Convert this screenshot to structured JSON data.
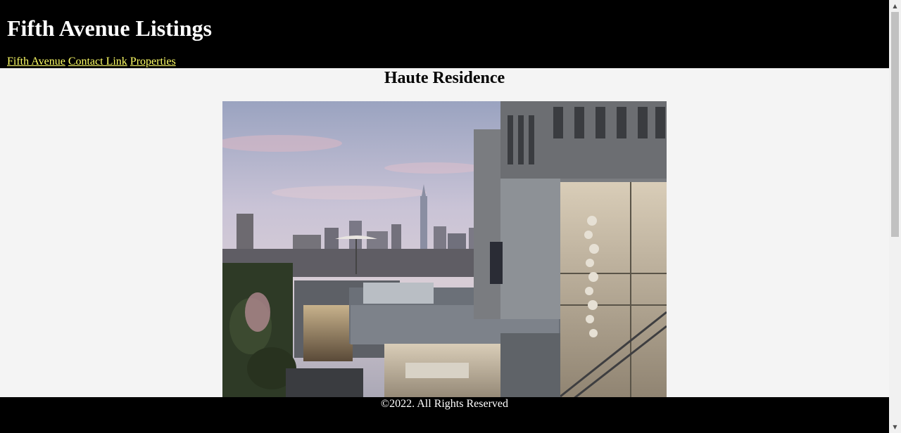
{
  "header": {
    "title": "Fifth Avenue Listings",
    "nav": [
      {
        "label": "Fifth Avenue"
      },
      {
        "label": "Contact Link"
      },
      {
        "label": "Properties"
      }
    ]
  },
  "main": {
    "heading": "Haute Residence"
  },
  "footer": {
    "text": "©2022. All Rights Reserved"
  },
  "scrollbar": {
    "up_icon": "triangle-up",
    "down_icon": "triangle-down"
  },
  "colors": {
    "header_bg": "#000000",
    "nav_link": "#ffff66",
    "page_bg": "#f4f4f4",
    "footer_bg": "#000000"
  }
}
